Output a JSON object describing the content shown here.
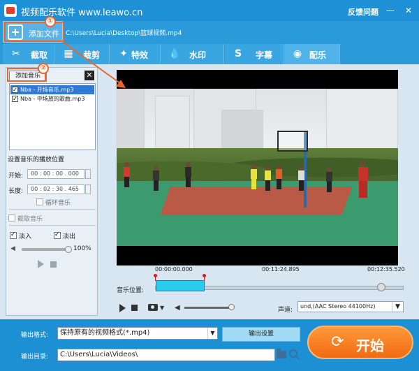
{
  "titlebar": {
    "title": "视频配乐软件 www.leawo.cn",
    "feedback": "反馈问题",
    "minimize": "—",
    "close": "✕"
  },
  "toolbar": {
    "add_file": "添加文件",
    "file_path": "C:\\Users\\Lucia\\Desktop\\篮球视频.mp4"
  },
  "annotations": {
    "badge1": "①",
    "badge2": "②"
  },
  "tabs": [
    {
      "label": "截取",
      "icon": "✂"
    },
    {
      "label": "裁剪",
      "icon": "▦"
    },
    {
      "label": "特效",
      "icon": "✦"
    },
    {
      "label": "水印",
      "icon": "💧"
    },
    {
      "label": "字幕",
      "icon": "S"
    },
    {
      "label": "配乐",
      "icon": "◉"
    }
  ],
  "music_panel": {
    "add_music": "添加音乐",
    "close": "✕",
    "items": [
      {
        "name": "Nba - 开场音乐.mp3",
        "checked": true,
        "selected": true
      },
      {
        "name": "Nba - 中场放的歌曲.mp3",
        "checked": true,
        "selected": false
      }
    ],
    "position_title": "设置音乐的播放位置",
    "start_label": "开始:",
    "start_value": "00 : 00 : 00 . 000",
    "length_label": "长度:",
    "length_value": "00 : 02 : 30 . 465",
    "loop_label": "循环音乐",
    "trim_label": "截取音乐",
    "fade_in": "淡入",
    "fade_out": "淡出",
    "volume_percent": "100%"
  },
  "timeline": {
    "time_start": "00:00:00.000",
    "time_mid": "00:11:24.895",
    "time_end": "00:12:35.520",
    "music_position_label": "音乐位置:"
  },
  "controls": {
    "channel_label": "声道:",
    "channel_value": "und,(AAC Stereo 44100Hz)"
  },
  "output": {
    "format_label": "输出格式:",
    "format_value": "保持原有的视频格式(*.mp4)",
    "settings_button": "输出设置",
    "dir_label": "输出目录:",
    "dir_value": "C:\\Users\\Lucia\\Videos\\",
    "start_button": "开始"
  },
  "colors": {
    "titlebar": "#1e90d6",
    "accent_orange": "#f26a12",
    "annotation": "#e8672f",
    "selection": "#2f7ad6",
    "music_segment": "#2bcbf0"
  }
}
